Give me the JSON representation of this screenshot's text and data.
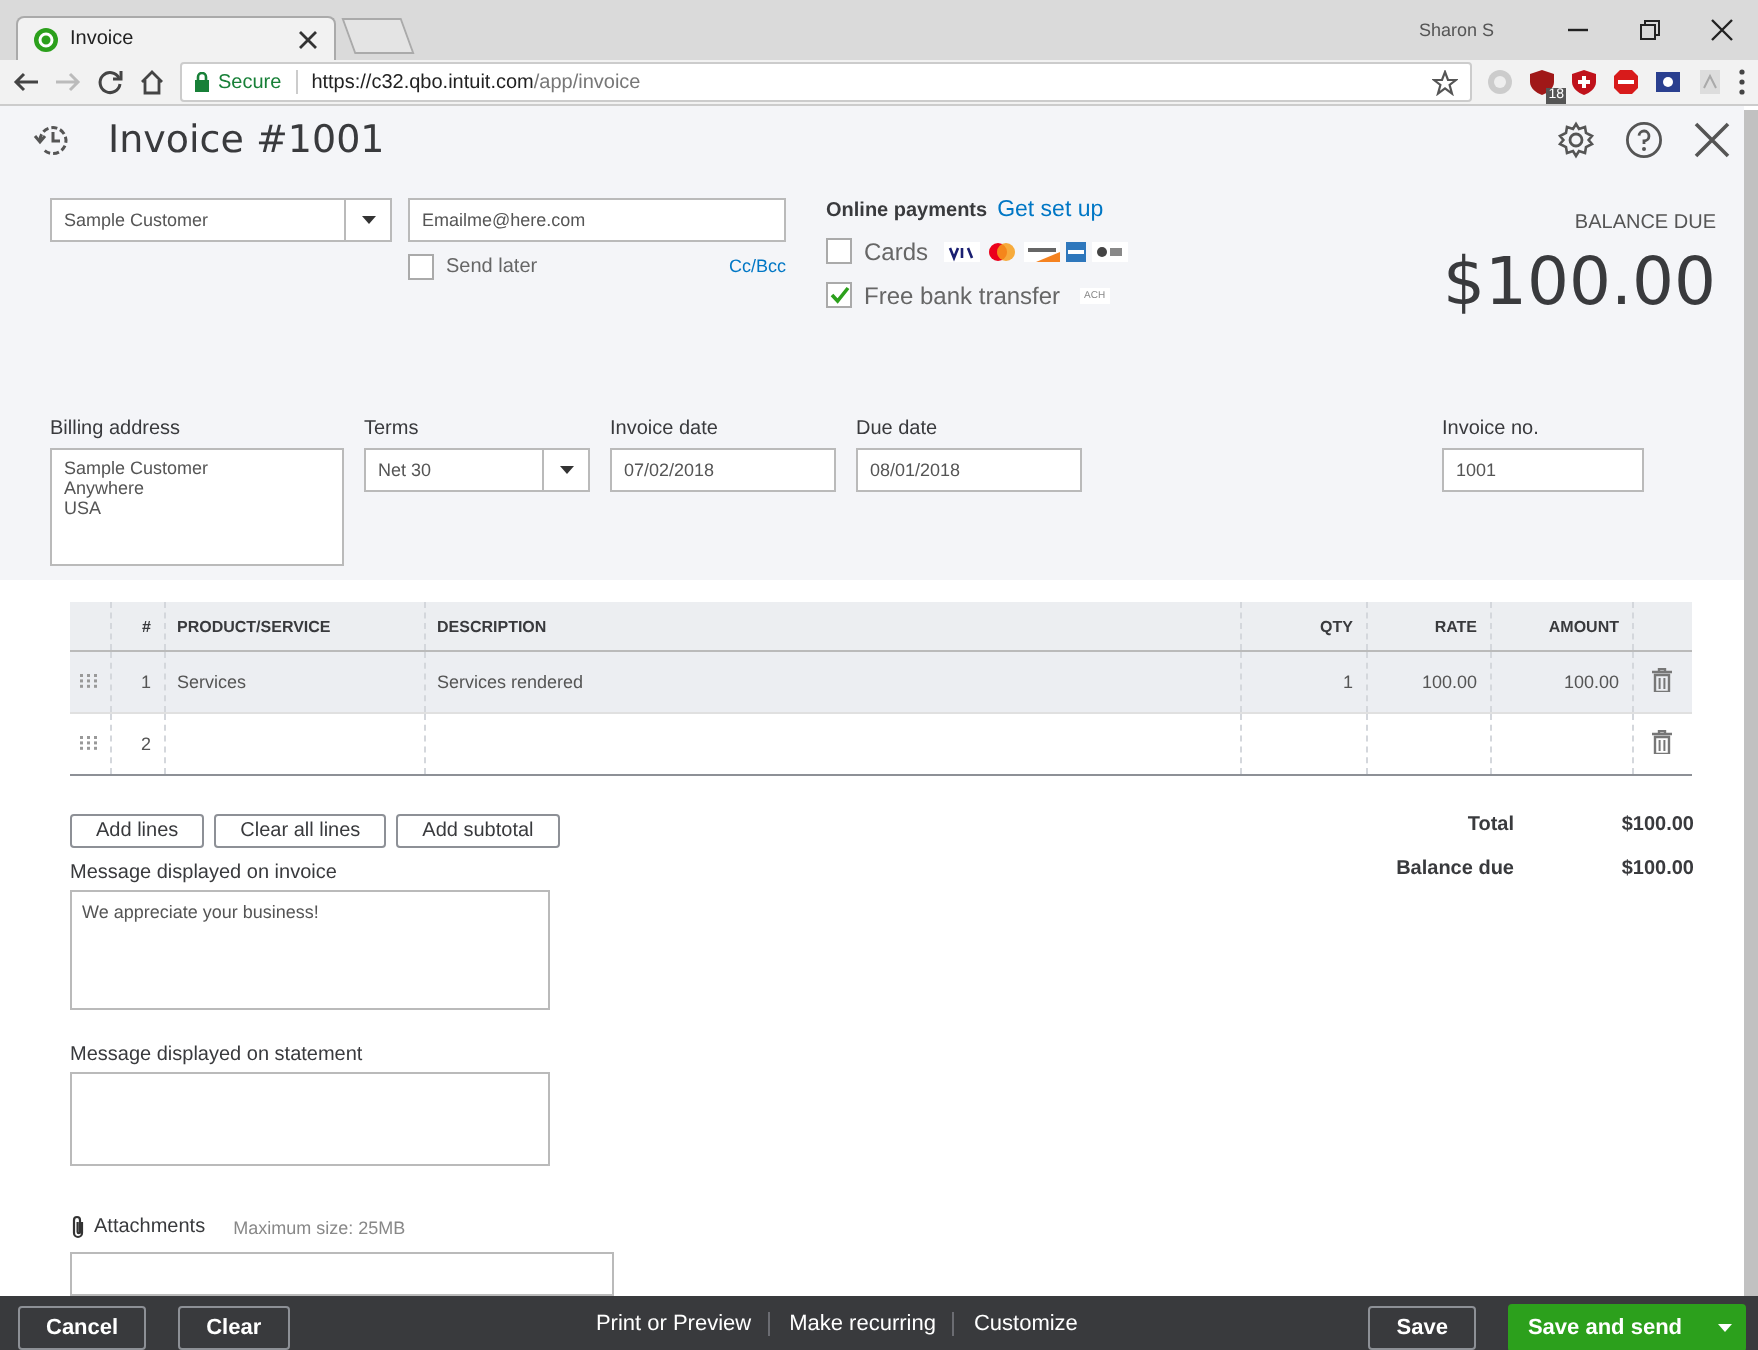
{
  "browser": {
    "tab_title": "Invoice",
    "user": "Sharon S",
    "secure_label": "Secure",
    "url_host": "https://c32.qbo.intuit.com",
    "url_path": "/app/invoice",
    "extension_badge": "18"
  },
  "header": {
    "title": "Invoice #1001"
  },
  "customer": {
    "value": "Sample Customer"
  },
  "email": {
    "value": "Emailme@here.com",
    "send_later": {
      "label": "Send later",
      "checked": false
    },
    "cc_bcc": "Cc/Bcc"
  },
  "online_payments": {
    "label": "Online payments",
    "link": "Get set up",
    "options": [
      {
        "kind": "cards",
        "label": "Cards",
        "checked": false
      },
      {
        "kind": "ach",
        "label": "Free bank transfer",
        "checked": true,
        "badge": "ACH"
      }
    ]
  },
  "balance": {
    "label": "BALANCE DUE",
    "amount": "$100.00"
  },
  "billing_address": {
    "label": "Billing address",
    "lines": [
      "Sample Customer",
      "Anywhere",
      "USA"
    ]
  },
  "terms": {
    "label": "Terms",
    "value": "Net 30"
  },
  "invoice_date": {
    "label": "Invoice date",
    "value": "07/02/2018"
  },
  "due_date": {
    "label": "Due date",
    "value": "08/01/2018"
  },
  "invoice_no": {
    "label": "Invoice no.",
    "value": "1001"
  },
  "table": {
    "columns": [
      "#",
      "PRODUCT/SERVICE",
      "DESCRIPTION",
      "QTY",
      "RATE",
      "AMOUNT"
    ],
    "rows": [
      {
        "number": "1",
        "product": "Services",
        "description": "Services rendered",
        "qty": "1",
        "rate": "100.00",
        "amount": "100.00",
        "selected": true
      },
      {
        "number": "2",
        "selected": false
      }
    ]
  },
  "line_buttons": [
    "Add lines",
    "Clear all lines",
    "Add subtotal"
  ],
  "totals": [
    {
      "label": "Total",
      "value": "$100.00"
    },
    {
      "label": "Balance due",
      "value": "$100.00"
    }
  ],
  "invoice_message": {
    "label": "Message displayed on invoice",
    "value": "We appreciate your business!"
  },
  "statement_message": {
    "label": "Message displayed on statement"
  },
  "attachments": {
    "label": "Attachments",
    "hint": "Maximum size: 25MB"
  },
  "footer": {
    "left": [
      "Cancel",
      "Clear"
    ],
    "center": [
      "Print or Preview",
      "Make recurring",
      "Customize"
    ],
    "save": "Save",
    "save_and_send": "Save and send"
  }
}
